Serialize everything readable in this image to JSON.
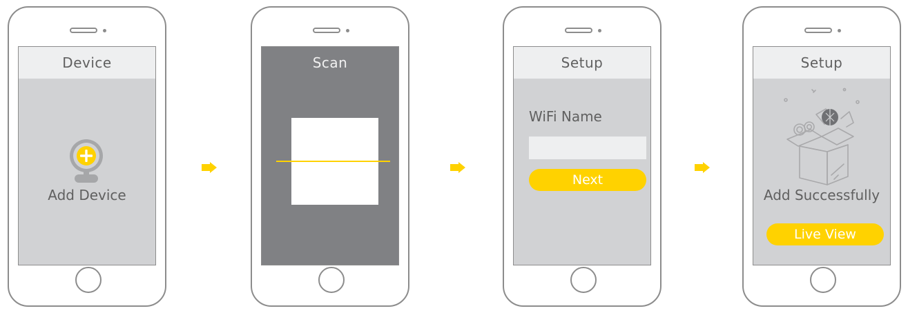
{
  "steps": [
    {
      "header": "Device",
      "add_label": "Add Device"
    },
    {
      "header": "Scan"
    },
    {
      "header": "Setup",
      "wifi_label": "WiFi Name",
      "wifi_input_value": "",
      "next_label": "Next"
    },
    {
      "header": "Setup",
      "success_label": "Add Successfully",
      "live_view_label": "Live View"
    }
  ],
  "colors": {
    "accent": "#ffd200",
    "screen_light": "#d1d2d4",
    "screen_dark": "#808184",
    "header_light": "#eeeff0",
    "outline": "#8c8c8c",
    "text": "#606060"
  },
  "icons": {
    "add_device": "camera-plus-icon",
    "step_arrow": "arrow-right-icon",
    "success": "open-box-icon"
  }
}
